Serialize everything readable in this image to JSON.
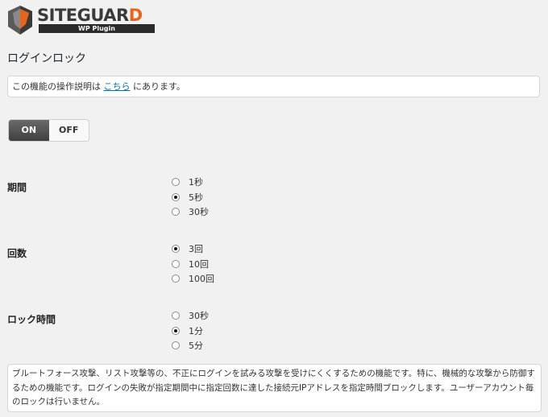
{
  "logo": {
    "word_main": "SITEGUAR",
    "word_accent": "D",
    "subtitle": "WP Plugin"
  },
  "page_title": "ログインロック",
  "info": {
    "prefix": "この機能の操作説明は ",
    "link": "こちら",
    "suffix": " にあります。"
  },
  "toggle": {
    "on_label": "ON",
    "off_label": "OFF",
    "selected": "ON"
  },
  "fields": [
    {
      "label": "期間",
      "options": [
        "1秒",
        "5秒",
        "30秒"
      ],
      "selected": 1
    },
    {
      "label": "回数",
      "options": [
        "3回",
        "10回",
        "100回"
      ],
      "selected": 0
    },
    {
      "label": "ロック時間",
      "options": [
        "30秒",
        "1分",
        "5分"
      ],
      "selected": 1
    }
  ],
  "description": "ブルートフォース攻撃、リスト攻撃等の、不正にログインを試みる攻撃を受けにくくするための機能です。特に、機械的な攻撃から防御するための機能です。ログインの失敗が指定期間中に指定回数に達した接続元IPアドレスを指定時間ブロックします。ユーザーアカウント毎のロックは行いません。",
  "colors": {
    "accent": "#e8641b",
    "link": "#0073aa",
    "background": "#f1f1f1"
  }
}
